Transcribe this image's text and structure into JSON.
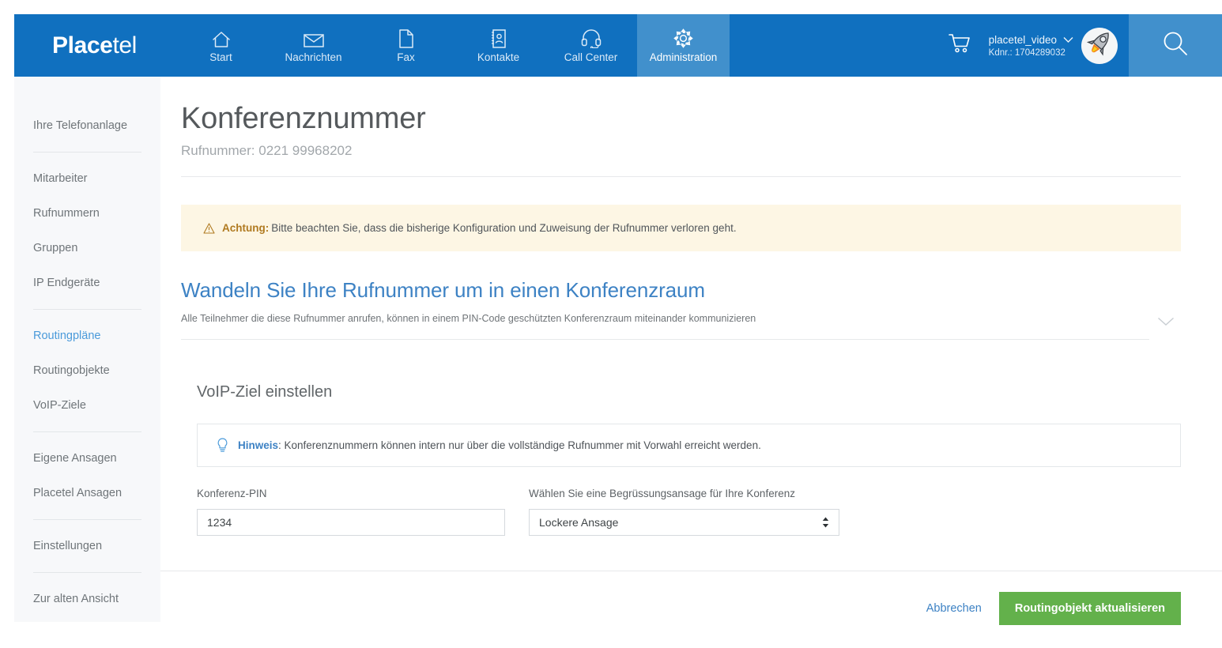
{
  "brand": {
    "name_bold": "Place",
    "name_thin": "tel",
    "primary": "#1070bf",
    "active_tab": "#4190cc"
  },
  "header": {
    "nav": [
      {
        "label": "Start",
        "icon": "home-icon",
        "active": false
      },
      {
        "label": "Nachrichten",
        "icon": "envelope-icon",
        "active": false
      },
      {
        "label": "Fax",
        "icon": "document-icon",
        "active": false
      },
      {
        "label": "Kontakte",
        "icon": "address-book-icon",
        "active": false
      },
      {
        "label": "Call Center",
        "icon": "headset-icon",
        "active": false
      },
      {
        "label": "Administration",
        "icon": "gear-icon",
        "active": true
      }
    ],
    "cart_icon": "shopping-cart-icon",
    "account_name": "placetel_video",
    "account_chevron": "chevron-down-icon",
    "account_kdnr": "Kdnr.: 1704289032",
    "avatar_icon": "rocket-avatar-icon",
    "search_icon": "search-icon"
  },
  "sidebar": {
    "items": [
      {
        "label": "Ihre Telefonanlage",
        "active": false
      },
      {
        "label": "Mitarbeiter",
        "active": false
      },
      {
        "label": "Rufnummern",
        "active": false
      },
      {
        "label": "Gruppen",
        "active": false
      },
      {
        "label": "IP Endgeräte",
        "active": false
      },
      {
        "label": "Routingpläne",
        "active": true
      },
      {
        "label": "Routingobjekte",
        "active": false
      },
      {
        "label": "VoIP-Ziele",
        "active": false
      },
      {
        "label": "Eigene Ansagen",
        "active": false
      },
      {
        "label": "Placetel Ansagen",
        "active": false
      },
      {
        "label": "Einstellungen",
        "active": false
      },
      {
        "label": "Zur alten Ansicht",
        "active": false
      }
    ]
  },
  "main": {
    "title": "Konferenznummer",
    "subtitle": "Rufnummer: 0221 99968202",
    "warning": {
      "icon": "warning-triangle-icon",
      "strong": "Achtung:",
      "text": "Bitte beachten Sie, dass die bisherige Konfiguration und Zuweisung der Rufnummer verloren geht.",
      "background": "#fdf6e4",
      "strong_color": "#b07a20"
    },
    "convert": {
      "heading": "Wandeln Sie Ihre Rufnummer um in einen Konferenzraum",
      "description": "Alle Teilnehmer die diese Rufnummer anrufen, können in einem PIN-Code geschützten Konferenzraum miteinander kommunizieren",
      "collapse_icon": "chevron-down-icon"
    },
    "voip": {
      "heading": "VoIP-Ziel einstellen",
      "hint": {
        "icon": "lightbulb-icon",
        "strong": "Hinweis",
        "text": ": Konferenznummern können intern nur über die vollständige Rufnummer mit Vorwahl erreicht werden.",
        "strong_color": "#3d82c4"
      },
      "pin_label": "Konferenz-PIN",
      "pin_value": "1234",
      "pin_placeholder": "",
      "ansage_label": "Wählen Sie eine Begrüssungsansage für Ihre Konferenz",
      "ansage_value": "Lockere Ansage",
      "ansage_spinner_icon": "updown-spinner-icon"
    },
    "footer": {
      "cancel_label": "Abbrechen",
      "submit_label": "Routingobjekt aktualisieren",
      "submit_color": "#63b14b"
    }
  }
}
